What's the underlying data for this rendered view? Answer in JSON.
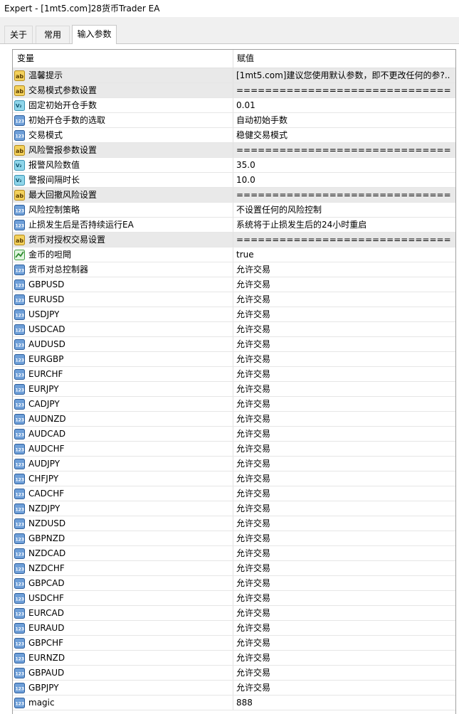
{
  "window": {
    "title": "Expert - [1mt5.com]28货币Trader EA"
  },
  "tabs": [
    {
      "label": "关于"
    },
    {
      "label": "常用"
    },
    {
      "label": "输入参数"
    }
  ],
  "grid": {
    "columns": {
      "variable": "变量",
      "value": "赋值"
    },
    "rows": [
      {
        "icon": "string-icon",
        "name": "温馨提示",
        "value": "[1mt5.com]建议您使用默认参数，即不更改任何的参?.."
      },
      {
        "icon": "string-icon",
        "name": "交易模式参数设置",
        "value": "=============================="
      },
      {
        "icon": "double-icon",
        "name": "固定初始开仓手数",
        "value": "0.01"
      },
      {
        "icon": "integer-icon",
        "name": "初始开仓手数的选取",
        "value": "自动初始手数"
      },
      {
        "icon": "integer-icon",
        "name": "交易模式",
        "value": "稳健交易模式"
      },
      {
        "icon": "string-icon",
        "name": "风险警报参数设置",
        "value": "=============================="
      },
      {
        "icon": "double-icon",
        "name": "报警风险数值",
        "value": "35.0"
      },
      {
        "icon": "double-icon",
        "name": "警报间隔时长",
        "value": "10.0"
      },
      {
        "icon": "string-icon",
        "name": "最大回撤风险设置",
        "value": "=============================="
      },
      {
        "icon": "integer-icon",
        "name": "风险控制策略",
        "value": "不设置任何的风险控制"
      },
      {
        "icon": "integer-icon",
        "name": "止损发生后是否持续运行EA",
        "value": "系统将于止损发生后的24小时重启"
      },
      {
        "icon": "string-icon",
        "name": "货币对授权交易设置",
        "value": "=============================="
      },
      {
        "icon": "bool-icon",
        "name": "金币的呾閜",
        "value": "true"
      },
      {
        "icon": "integer-icon",
        "name": "货币对总控制器",
        "value": "允许交易"
      },
      {
        "icon": "integer-icon",
        "name": "GBPUSD",
        "value": "允许交易"
      },
      {
        "icon": "integer-icon",
        "name": "EURUSD",
        "value": "允许交易"
      },
      {
        "icon": "integer-icon",
        "name": "USDJPY",
        "value": "允许交易"
      },
      {
        "icon": "integer-icon",
        "name": "USDCAD",
        "value": "允许交易"
      },
      {
        "icon": "integer-icon",
        "name": "AUDUSD",
        "value": "允许交易"
      },
      {
        "icon": "integer-icon",
        "name": "EURGBP",
        "value": "允许交易"
      },
      {
        "icon": "integer-icon",
        "name": "EURCHF",
        "value": "允许交易"
      },
      {
        "icon": "integer-icon",
        "name": "EURJPY",
        "value": "允许交易"
      },
      {
        "icon": "integer-icon",
        "name": "CADJPY",
        "value": "允许交易"
      },
      {
        "icon": "integer-icon",
        "name": "AUDNZD",
        "value": "允许交易"
      },
      {
        "icon": "integer-icon",
        "name": "AUDCAD",
        "value": "允许交易"
      },
      {
        "icon": "integer-icon",
        "name": "AUDCHF",
        "value": "允许交易"
      },
      {
        "icon": "integer-icon",
        "name": "AUDJPY",
        "value": "允许交易"
      },
      {
        "icon": "integer-icon",
        "name": "CHFJPY",
        "value": "允许交易"
      },
      {
        "icon": "integer-icon",
        "name": "CADCHF",
        "value": "允许交易"
      },
      {
        "icon": "integer-icon",
        "name": "NZDJPY",
        "value": "允许交易"
      },
      {
        "icon": "integer-icon",
        "name": "NZDUSD",
        "value": "允许交易"
      },
      {
        "icon": "integer-icon",
        "name": "GBPNZD",
        "value": "允许交易"
      },
      {
        "icon": "integer-icon",
        "name": "NZDCAD",
        "value": "允许交易"
      },
      {
        "icon": "integer-icon",
        "name": "NZDCHF",
        "value": "允许交易"
      },
      {
        "icon": "integer-icon",
        "name": "GBPCAD",
        "value": "允许交易"
      },
      {
        "icon": "integer-icon",
        "name": "USDCHF",
        "value": "允许交易"
      },
      {
        "icon": "integer-icon",
        "name": "EURCAD",
        "value": "允许交易"
      },
      {
        "icon": "integer-icon",
        "name": "EURAUD",
        "value": "允许交易"
      },
      {
        "icon": "integer-icon",
        "name": "GBPCHF",
        "value": "允许交易"
      },
      {
        "icon": "integer-icon",
        "name": "EURNZD",
        "value": "允许交易"
      },
      {
        "icon": "integer-icon",
        "name": "GBPAUD",
        "value": "允许交易"
      },
      {
        "icon": "integer-icon",
        "name": "GBPJPY",
        "value": "允许交易"
      },
      {
        "icon": "integer-icon",
        "name": "magic",
        "value": "888"
      }
    ]
  }
}
